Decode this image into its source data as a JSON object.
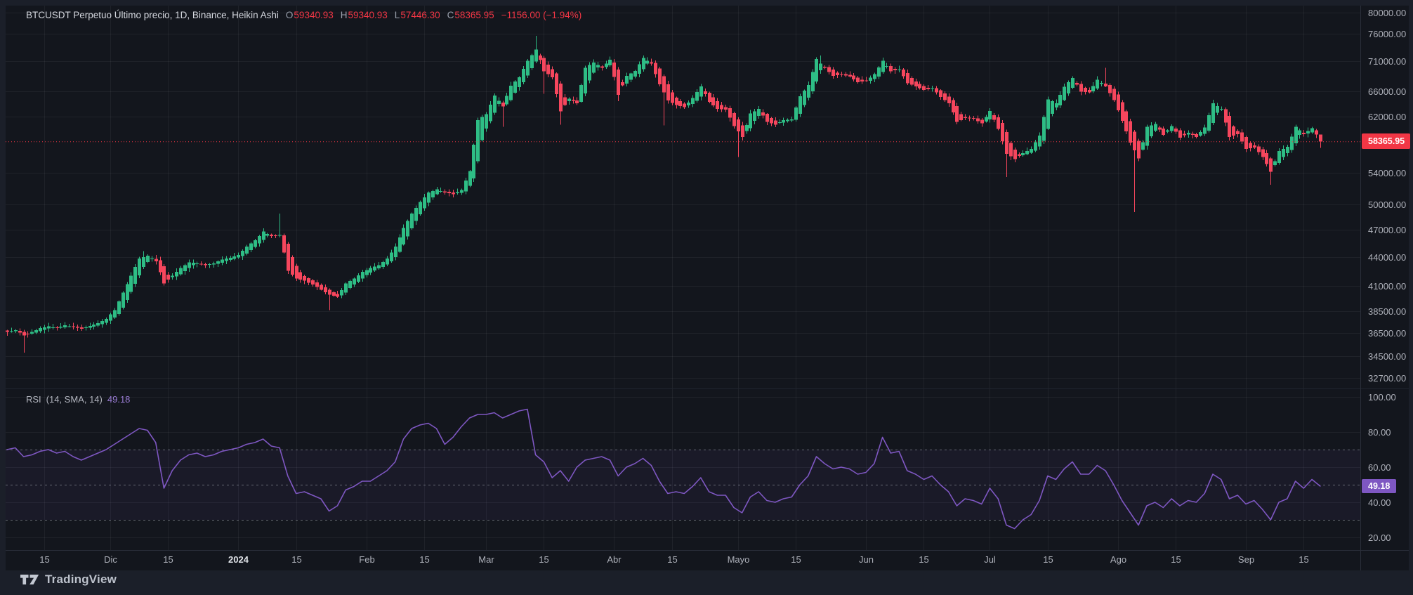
{
  "header": {
    "title": "BTCUSDT Perpetuo Último precio, 1D, Binance, Heikin Ashi",
    "o_label": "O",
    "o": "59340.93",
    "h_label": "H",
    "h": "59340.93",
    "l_label": "L",
    "l": "57446.30",
    "c_label": "C",
    "c": "58365.95",
    "change": "−1156.00 (−1.94%)"
  },
  "rsi_header": {
    "title": "RSI",
    "params": "(14, SMA, 14)",
    "value": "49.18"
  },
  "badges": {
    "price": "58365.95",
    "rsi": "49.18"
  },
  "footer": {
    "logo_text": "TradingView"
  },
  "colors": {
    "up": "#2ebd85",
    "down": "#f6465d",
    "last_price": "#f23645",
    "rsi_line": "#7e57c2",
    "rsi_band": "rgba(126,87,194,0.07)",
    "dashed_level": "rgba(178,183,194,0.5)",
    "grid": "rgba(255,255,255,0.055)"
  },
  "axes": {
    "price_ticks": [
      {
        "label": "80000.00",
        "value": 80000
      },
      {
        "label": "76000.00",
        "value": 76000
      },
      {
        "label": "71000.00",
        "value": 71000
      },
      {
        "label": "66000.00",
        "value": 66000
      },
      {
        "label": "62000.00",
        "value": 62000
      },
      {
        "label": "54000.00",
        "value": 54000
      },
      {
        "label": "50000.00",
        "value": 50000
      },
      {
        "label": "47000.00",
        "value": 47000
      },
      {
        "label": "44000.00",
        "value": 44000
      },
      {
        "label": "41000.00",
        "value": 41000
      },
      {
        "label": "38500.00",
        "value": 38500
      },
      {
        "label": "36500.00",
        "value": 36500
      },
      {
        "label": "34500.00",
        "value": 34500
      },
      {
        "label": "32700.00",
        "value": 32700
      }
    ],
    "rsi_ticks": [
      {
        "label": "100.00",
        "value": 100
      },
      {
        "label": "80.00",
        "value": 80
      },
      {
        "label": "60.00",
        "value": 60
      },
      {
        "label": "40.00",
        "value": 40
      },
      {
        "label": "20.00",
        "value": 20
      }
    ],
    "time_ticks": [
      {
        "label": "15",
        "day": 9
      },
      {
        "label": "Dic",
        "day": 25
      },
      {
        "label": "15",
        "day": 39
      },
      {
        "label": "2024",
        "day": 56,
        "bold": true
      },
      {
        "label": "15",
        "day": 70
      },
      {
        "label": "Feb",
        "day": 87
      },
      {
        "label": "15",
        "day": 101
      },
      {
        "label": "Mar",
        "day": 116
      },
      {
        "label": "15",
        "day": 130
      },
      {
        "label": "Abr",
        "day": 147
      },
      {
        "label": "15",
        "day": 161
      },
      {
        "label": "Mayo",
        "day": 177
      },
      {
        "label": "15",
        "day": 191
      },
      {
        "label": "Jun",
        "day": 208
      },
      {
        "label": "15",
        "day": 222
      },
      {
        "label": "Jul",
        "day": 238
      },
      {
        "label": "15",
        "day": 252
      },
      {
        "label": "Ago",
        "day": 269
      },
      {
        "label": "15",
        "day": 283
      },
      {
        "label": "Sep",
        "day": 300
      },
      {
        "label": "15",
        "day": 314
      }
    ]
  },
  "chart_data": {
    "type": "candlestick",
    "style": "heikin-ashi",
    "symbol": "BTCUSDT Perpetual",
    "exchange": "Binance",
    "interval": "1D",
    "price_scale": "logarithmic",
    "x_range": [
      "2023-11-06",
      "2024-09-19"
    ],
    "ylim": [
      32700,
      80000
    ],
    "grid": true,
    "ohlc_last": {
      "open": 59340.93,
      "high": 59340.93,
      "low": 57446.3,
      "close": 58365.95,
      "change": -1156.0,
      "change_pct": -1.94
    },
    "sample_interval_days": 2,
    "closes_2d": [
      36600,
      36750,
      36300,
      36600,
      36950,
      37100,
      36950,
      37200,
      37050,
      36900,
      37150,
      37400,
      37800,
      38600,
      40300,
      42000,
      43800,
      44100,
      43500,
      41200,
      42000,
      42800,
      43400,
      43300,
      43100,
      43300,
      43700,
      43900,
      44200,
      45100,
      45800,
      46800,
      46300,
      46400,
      42500,
      41700,
      41500,
      41100,
      40600,
      40100,
      39900,
      41200,
      41700,
      42400,
      42800,
      43100,
      43800,
      45100,
      47200,
      48900,
      50300,
      51500,
      51900,
      51500,
      51300,
      51800,
      54300,
      61500,
      62400,
      65300,
      63600,
      66900,
      68300,
      71100,
      73100,
      69300,
      68300,
      62800,
      64800,
      64100,
      69900,
      70800,
      69900,
      71300,
      65400,
      68500,
      69350,
      71600,
      70600,
      67100,
      64500,
      63800,
      63500,
      64900,
      66800,
      64300,
      63200,
      63100,
      60600,
      59000,
      62500,
      63200,
      61200,
      60800,
      61500,
      61600,
      65200,
      67000,
      71400,
      69900,
      68500,
      68800,
      68400,
      67500,
      67700,
      68800,
      71100,
      69300,
      69600,
      67300,
      66800,
      66200,
      66500,
      65100,
      64100,
      61200,
      61800,
      61700,
      61000,
      62900,
      60200,
      56600,
      55900,
      56700,
      57300,
      59200,
      64700,
      64100,
      66700,
      68200,
      65900,
      65800,
      67900,
      66800,
      64600,
      61400,
      58200,
      56000,
      60500,
      60900,
      59300,
      60600,
      58900,
      59600,
      59000,
      60400,
      64100,
      63200,
      59000,
      59400,
      57300,
      57500,
      56200,
      54200,
      57000,
      57600,
      60500,
      59400,
      60300,
      58366
    ],
    "wick_overrides": {
      "4": [
        null,
        34800
      ],
      "33": [
        44600,
        null
      ],
      "66": [
        48900,
        null
      ],
      "78": [
        null,
        38600
      ],
      "120": [
        null,
        60500
      ],
      "128": [
        75600,
        null
      ],
      "130": [
        null,
        65600
      ],
      "134": [
        null,
        60800
      ],
      "148": [
        null,
        64400
      ],
      "159": [
        null,
        60700
      ],
      "177": [
        null,
        56200
      ],
      "197": [
        72000,
        null
      ],
      "242": [
        null,
        53500
      ],
      "266": [
        69900,
        null
      ],
      "273": [
        null,
        49100
      ],
      "306": [
        null,
        52500
      ]
    },
    "indicator": {
      "name": "RSI",
      "period": 14,
      "smoothing": "SMA 14",
      "last": 49.18,
      "levels": [
        70,
        50,
        30
      ],
      "range": [
        0,
        100
      ],
      "values_2d": [
        70,
        71,
        66,
        67,
        69,
        70,
        68,
        69,
        66,
        64,
        66,
        68,
        70,
        73,
        76,
        79,
        82,
        81,
        74,
        48,
        58,
        64,
        67,
        68,
        66,
        67,
        69,
        70,
        71,
        73,
        74,
        76,
        72,
        71,
        55,
        45,
        46,
        44,
        42,
        35,
        38,
        47,
        49,
        52,
        52,
        55,
        58,
        63,
        76,
        82,
        84,
        85,
        82,
        73,
        77,
        83,
        88,
        90,
        90,
        91,
        88,
        90,
        92,
        93,
        67,
        63,
        54,
        58,
        52,
        60,
        64,
        65,
        66,
        64,
        55,
        60,
        62,
        65,
        61,
        52,
        45,
        46,
        45,
        49,
        54,
        46,
        44,
        44,
        37,
        34,
        43,
        46,
        41,
        40,
        42,
        43,
        50,
        55,
        66,
        62,
        59,
        60,
        59,
        56,
        57,
        62,
        77,
        68,
        69,
        58,
        56,
        53,
        55,
        50,
        46,
        38,
        42,
        41,
        39,
        48,
        42,
        27,
        25,
        30,
        33,
        41,
        55,
        53,
        59,
        63,
        56,
        56,
        61,
        58,
        50,
        41,
        34,
        27,
        38,
        40,
        37,
        42,
        38,
        41,
        40,
        45,
        56,
        53,
        42,
        44,
        39,
        41,
        36,
        30,
        40,
        42,
        52,
        48,
        53,
        49.18
      ]
    }
  }
}
